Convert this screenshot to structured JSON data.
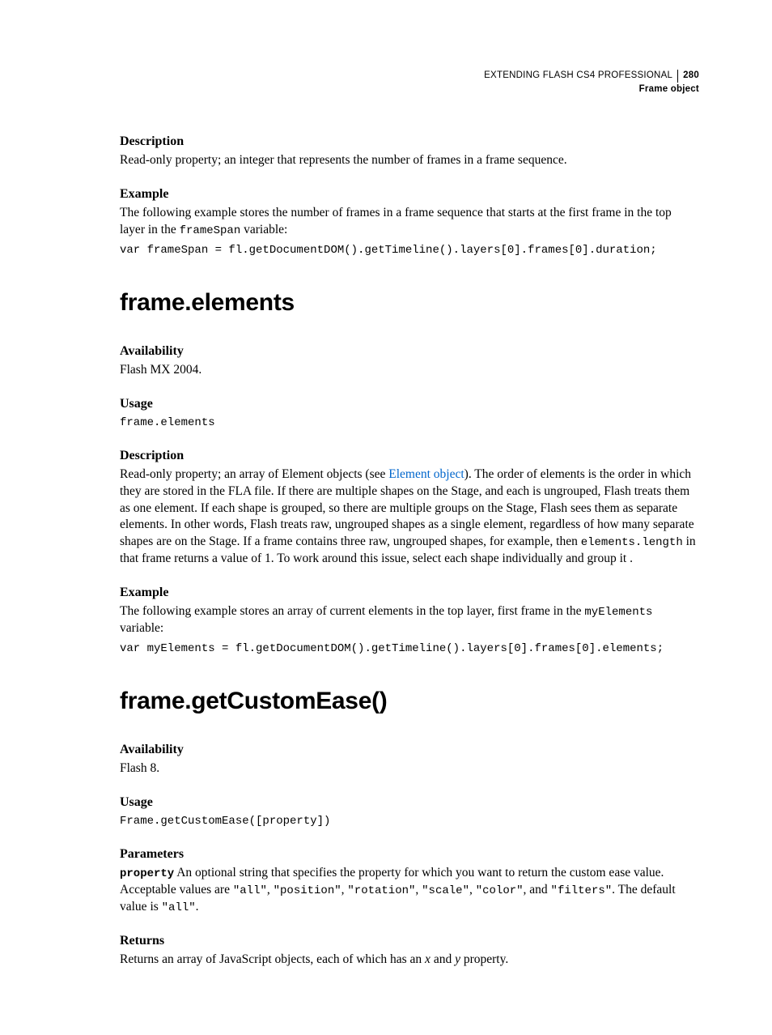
{
  "header": {
    "doc_title": "EXTENDING FLASH CS4 PROFESSIONAL",
    "page_number": "280",
    "section": "Frame object"
  },
  "sec_duration": {
    "desc_h": "Description",
    "desc_p": "Read-only property; an integer that represents the number of frames in a frame sequence.",
    "ex_h": "Example",
    "ex_p_pre": "The following example stores the number of frames in a frame sequence that starts at the first frame in the top layer in the ",
    "ex_p_var": "frameSpan",
    "ex_p_post": " variable:",
    "code": "var frameSpan = fl.getDocumentDOM().getTimeline().layers[0].frames[0].duration;"
  },
  "sec_elements": {
    "title": "frame.elements",
    "avail_h": "Availability",
    "avail_p": "Flash MX 2004.",
    "usage_h": "Usage",
    "usage_code": "frame.elements",
    "desc_h": "Description",
    "desc_p_pre": "Read-only property; an array of Element objects (see ",
    "desc_p_link": "Element object",
    "desc_p_mid": "). The order of elements is the order in which they are stored in the FLA file. If there are multiple shapes on the Stage, and each is ungrouped, Flash treats them as one element. If each shape is grouped, so there are multiple groups on the Stage, Flash sees them as separate elements. In other words, Flash treats raw, ungrouped shapes as a single element, regardless of how many separate shapes are on the Stage. If a frame contains three raw, ungrouped shapes, for example, then ",
    "desc_p_code": "elements.length",
    "desc_p_post": " in that frame returns a value of 1. To work around this issue, select each shape individually and group it .",
    "ex_h": "Example",
    "ex_p_pre": "The following example stores an array of current elements in the top layer, first frame in the ",
    "ex_p_var": "myElements",
    "ex_p_post": " variable:",
    "code": "var myElements = fl.getDocumentDOM().getTimeline().layers[0].frames[0].elements;"
  },
  "sec_getcustomease": {
    "title": "frame.getCustomEase()",
    "avail_h": "Availability",
    "avail_p": "Flash 8.",
    "usage_h": "Usage",
    "usage_code": "Frame.getCustomEase([property])",
    "params_h": "Parameters",
    "param_name": "property",
    "param_p1": "  An optional string that specifies the property for which you want to return the custom ease value. Acceptable values are ",
    "param_v1": "\"all\"",
    "param_c1": ", ",
    "param_v2": "\"position\"",
    "param_c2": ", ",
    "param_v3": "\"rotation\"",
    "param_c3": ", ",
    "param_v4": "\"scale\"",
    "param_c4": ", ",
    "param_v5": "\"color\"",
    "param_c5": ", and ",
    "param_v6": "\"filters\"",
    "param_p2": ". The default value is ",
    "param_v7": "\"all\"",
    "param_p3": ".",
    "returns_h": "Returns",
    "returns_p_pre": "Returns an array of JavaScript objects, each of which has an ",
    "returns_x": "x",
    "returns_mid": " and ",
    "returns_y": "y",
    "returns_post": " property."
  }
}
